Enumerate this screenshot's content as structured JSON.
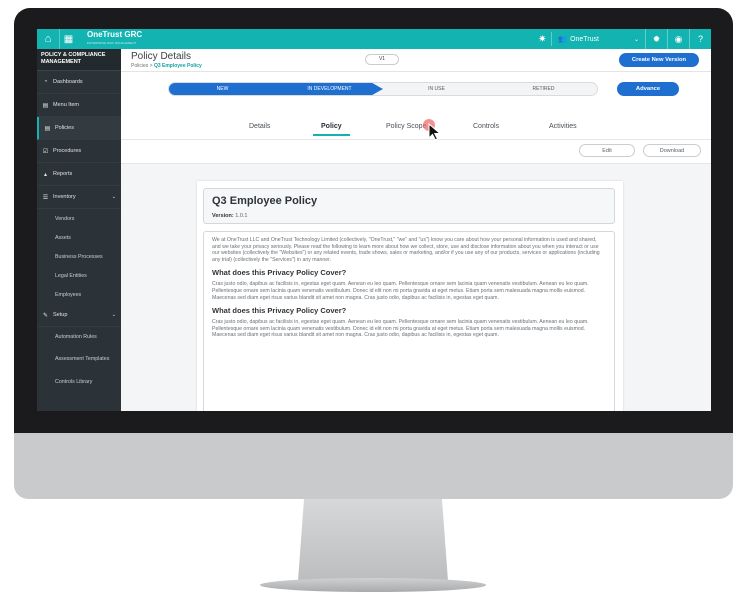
{
  "topbar": {
    "brand": "OneTrust GRC",
    "brand_sub": "ENTERPRISE RISK MANAGEMENT",
    "org": "OneTrust",
    "org_dropdown": "⌄",
    "accent": "#12b3b0"
  },
  "sidebar": {
    "title": "POLICY & COMPLIANCE MANAGEMENT",
    "items": [
      {
        "label": "Dashboards",
        "icon": "dashboard-icon"
      },
      {
        "label": "Menu Item",
        "icon": "document-icon"
      },
      {
        "label": "Policies",
        "icon": "document-icon"
      },
      {
        "label": "Procedures",
        "icon": "checkbox-icon"
      },
      {
        "label": "Reports",
        "icon": "chart-icon"
      },
      {
        "label": "Inventory",
        "icon": "list-icon"
      }
    ],
    "inventory_sub": [
      "Vendors",
      "Assets",
      "Business Processes",
      "Legal Entities",
      "Employees"
    ],
    "setup": {
      "label": "Setup",
      "icon": "wrench-icon"
    },
    "setup_sub": [
      "Automation Rules",
      "Assessment Templates",
      "Controls Library"
    ]
  },
  "header": {
    "title": "Policy Details",
    "breadcrumb_root": "Policies",
    "breadcrumb_sep": ">",
    "breadcrumb_current": "Q3 Employee Policy",
    "version": "V1",
    "new_version_label": "Create New Version"
  },
  "stages": {
    "items": [
      "NEW",
      "IN DEVELOPMENT",
      "IN USE",
      "RETIRED"
    ],
    "advance_label": "Advance",
    "color": "#1f6fd0"
  },
  "tabs": [
    "Details",
    "Policy",
    "Policy Scope",
    "Controls",
    "Activities"
  ],
  "actions": {
    "edit": "Edit",
    "download": "Download"
  },
  "document": {
    "title": "Q3 Employee Policy",
    "version_label": "Version:",
    "version_value": "1.0.1",
    "intro": "We at OneTrust LLC and OneTrust Technology Limited (collectively, \"OneTrust,\" \"we\" and \"us\") know you care about how your personal information is used and shared, and we take your privacy seriously. Please read the following to learn more about how we collect, store, use and disclose information about you when you interact or use our websites (collectively the \"Websites\") or any related events, trade shows, sales or marketing, and/or if you use any of our products, services or applications (including any trial) (collectively the \"Services\") in any manner.",
    "section1_heading": "What does this Privacy Policy Cover?",
    "section1_text": "Cras justo odio, dapibus ac facilisis in, egestas eget quam. Aenean eu leo quam. Pellentesque ornare sem lacinia quam venenatis vestibulum. Aenean eu leo quam. Pellentesque ornare sem lacinia quam venenatis vestibulum. Donec id elit non mi porta gravida at eget metus. Etiam porta sem malesuada magna mollis euismod. Maecenas sed diam eget risus varius blandit sit amet non magna. Cras justo odio, dapibus ac facilisis in, egestas eget quam.",
    "section2_heading": "What does this Privacy Policy Cover?",
    "section2_text": "Cras justo odio, dapibus ac facilisis in, egestas eget quam. Aenean eu leo quam. Pellentesque ornare sem lacinia quam venenatis vestibulum. Aenean eu leo quam. Pellentesque ornare sem lacinia quam venenatis vestibulum. Donec id elit non mi porta gravida at eget metus. Etiam porta sem malesuada magna mollis euismod. Maecenas sed diam eget risus varius blandit sit amet non magna. Cras justo odio, dapibus ac facilisis in, egestas eget quam."
  }
}
